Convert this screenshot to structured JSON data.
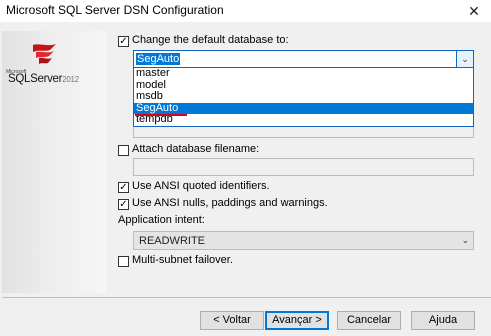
{
  "window": {
    "title": "Microsoft SQL Server DSN Configuration",
    "close_glyph": "✕"
  },
  "logo": {
    "microsoft": "Microsoft",
    "sql": "SQLServer",
    "version": "2012"
  },
  "default_db": {
    "checked": true,
    "label": "Change the default database to:",
    "selected": "SegAuto",
    "options": [
      "master",
      "model",
      "msdb",
      "SegAuto",
      "tempdb"
    ]
  },
  "attach": {
    "checked": false,
    "label": "Attach database filename:",
    "value": ""
  },
  "ansi_quoted": {
    "checked": true,
    "label": "Use ANSI quoted identifiers."
  },
  "ansi_nulls": {
    "checked": true,
    "label": "Use ANSI nulls, paddings and warnings."
  },
  "app_intent": {
    "label": "Application intent:",
    "value": "READWRITE"
  },
  "multisubnet": {
    "checked": false,
    "label": "Multi-subnet failover."
  },
  "buttons": {
    "back": "< Voltar",
    "next": "Avançar >",
    "cancel": "Cancelar",
    "help": "Ajuda"
  },
  "check_glyph": "✓"
}
